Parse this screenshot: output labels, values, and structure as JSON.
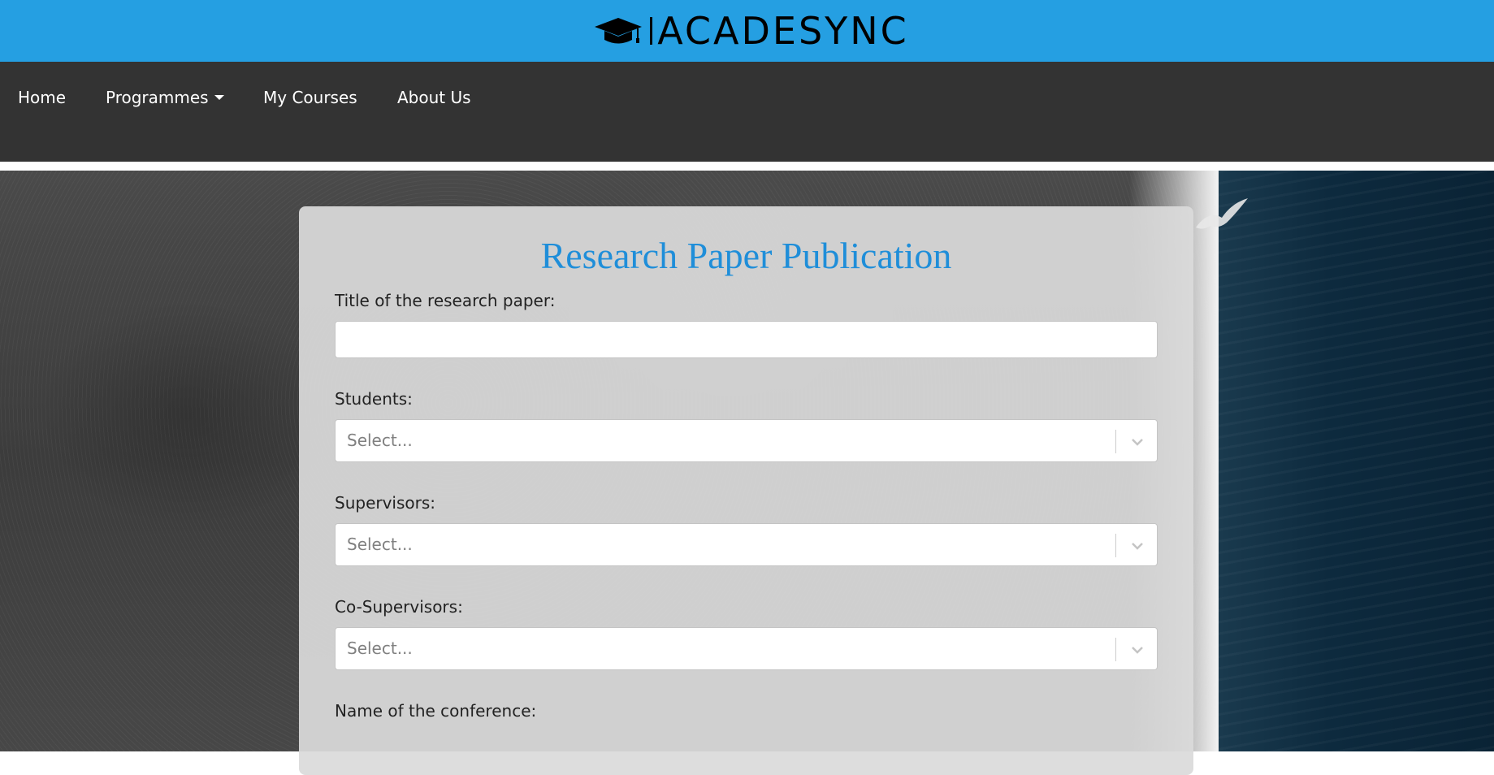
{
  "brand": {
    "name": "ACADESYNC",
    "icon": "graduation-cap-icon"
  },
  "nav": {
    "items": [
      {
        "label": "Home"
      },
      {
        "label": "Programmes",
        "has_dropdown": true
      },
      {
        "label": "My Courses"
      },
      {
        "label": "About Us"
      }
    ]
  },
  "form": {
    "title": "Research Paper Publication",
    "fields": [
      {
        "label": "Title of the research paper:",
        "type": "text",
        "value": ""
      },
      {
        "label": "Students:",
        "type": "select",
        "placeholder": "Select..."
      },
      {
        "label": "Supervisors:",
        "type": "select",
        "placeholder": "Select..."
      },
      {
        "label": "Co-Supervisors:",
        "type": "select",
        "placeholder": "Select..."
      },
      {
        "label": "Name of the conference:",
        "type": "text",
        "value": ""
      }
    ]
  },
  "colors": {
    "brand_bar": "#259fe2",
    "navbar": "#333333",
    "title": "#1f8ed9"
  }
}
